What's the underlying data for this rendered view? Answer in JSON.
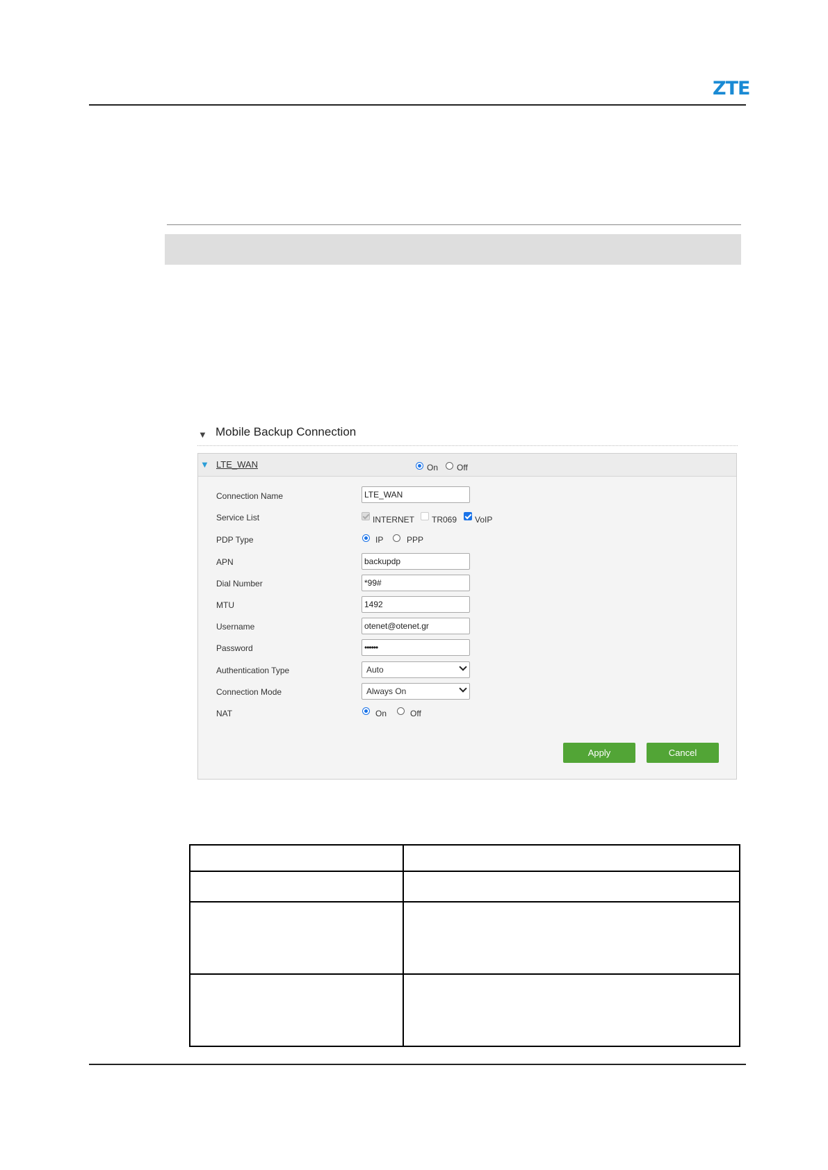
{
  "header": {
    "logo_text": "ZTE"
  },
  "section": {
    "title": "Mobile Backup Connection"
  },
  "panel": {
    "connection_link": "LTE_WAN",
    "enable_options": [
      "On",
      "Off"
    ],
    "enable_selected": "On",
    "fields": {
      "connection_name": {
        "label": "Connection Name",
        "value": "LTE_WAN"
      },
      "service_list": {
        "label": "Service List",
        "options": [
          {
            "label": "INTERNET",
            "checked": true,
            "disabled": true
          },
          {
            "label": "TR069",
            "checked": false,
            "disabled": true
          },
          {
            "label": "VoIP",
            "checked": true,
            "disabled": false
          }
        ]
      },
      "pdp_type": {
        "label": "PDP Type",
        "options": [
          "IP",
          "PPP"
        ],
        "selected": "IP"
      },
      "apn": {
        "label": "APN",
        "value": "backupdp"
      },
      "dial_number": {
        "label": "Dial Number",
        "value": "*99#"
      },
      "mtu": {
        "label": "MTU",
        "value": "1492"
      },
      "username": {
        "label": "Username",
        "value": "otenet@otenet.gr"
      },
      "password": {
        "label": "Password",
        "value": "••••••"
      },
      "auth_type": {
        "label": "Authentication Type",
        "value": "Auto"
      },
      "connection_mode": {
        "label": "Connection Mode",
        "value": "Always On"
      },
      "nat": {
        "label": "NAT",
        "options": [
          "On",
          "Off"
        ],
        "selected": "On"
      }
    },
    "buttons": {
      "apply": "Apply",
      "cancel": "Cancel"
    }
  },
  "colors": {
    "accent": "#52a536",
    "link_arrow": "#2b9ed8",
    "logo": "#1a8ad4"
  }
}
